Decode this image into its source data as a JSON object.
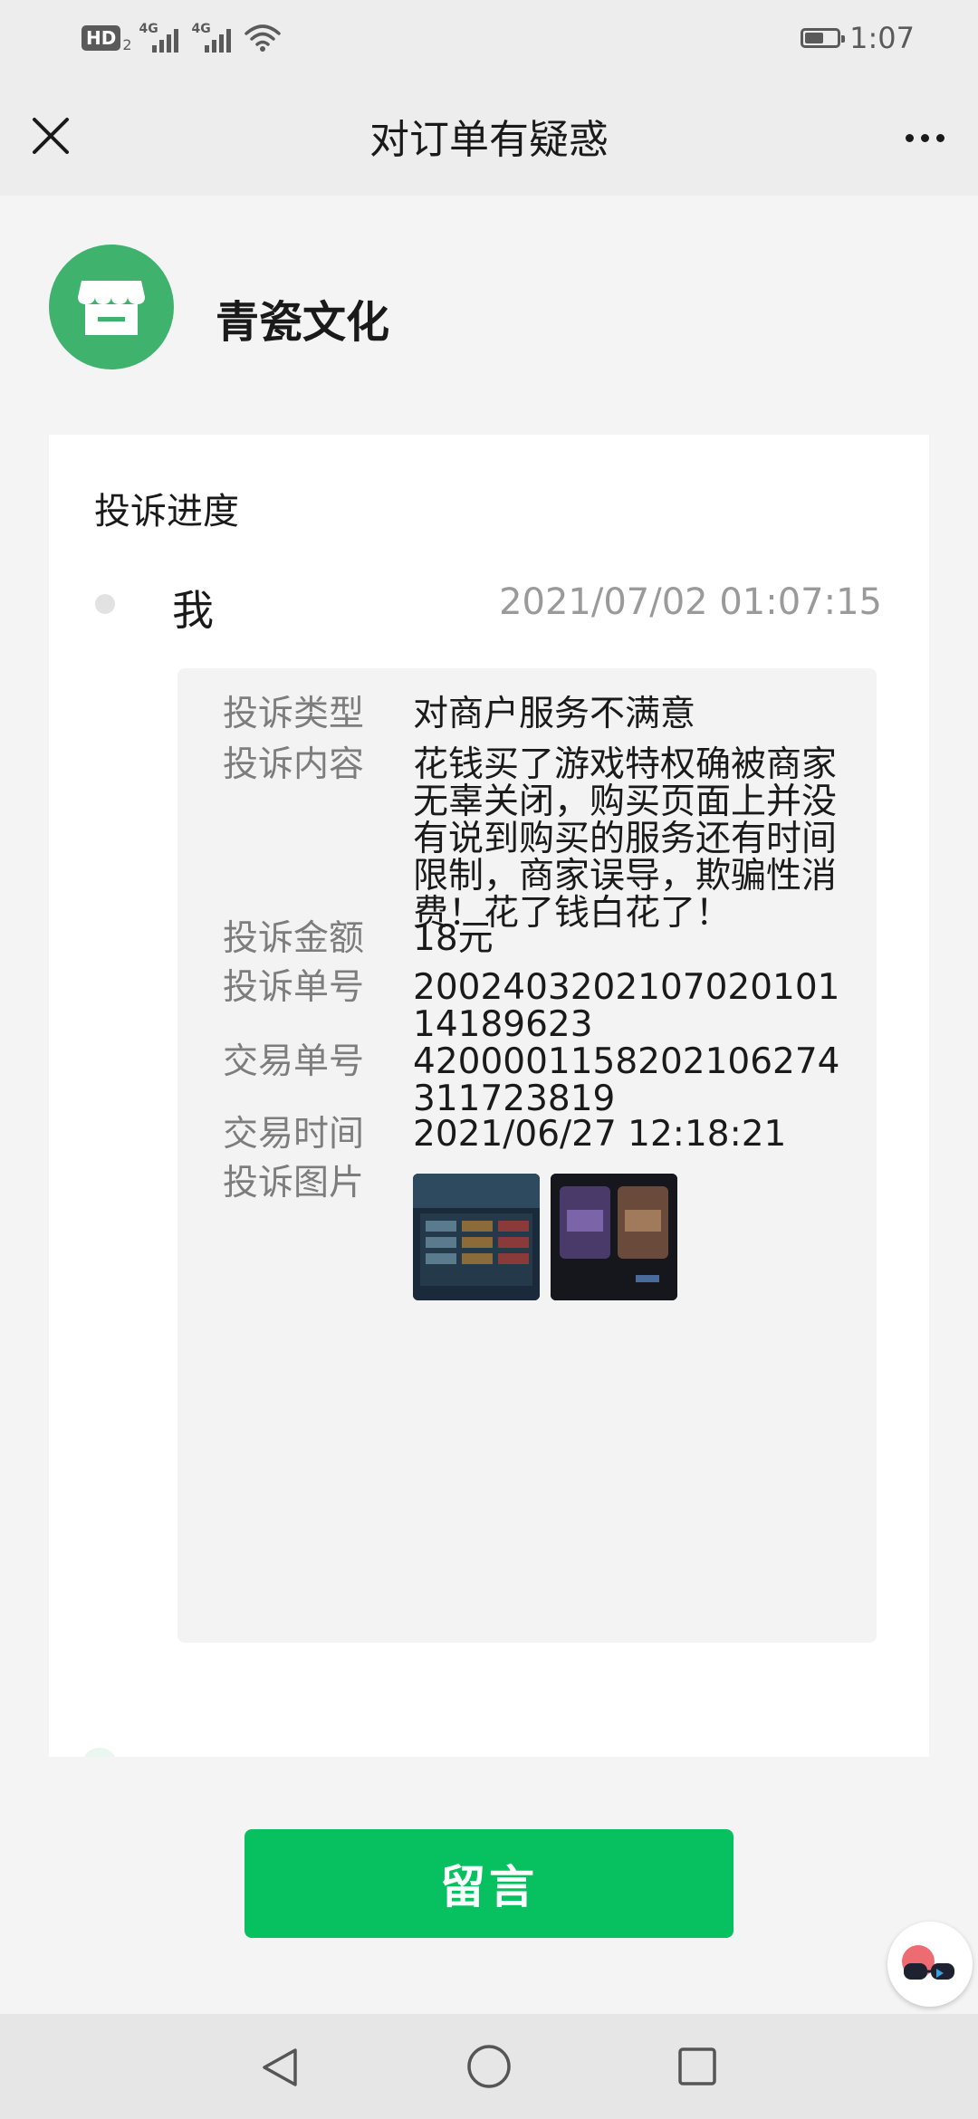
{
  "status_bar": {
    "hd": "HD",
    "hd_sub": "2",
    "network1": "4G",
    "network2": "4G",
    "battery_level": 0.6,
    "time": "1:07"
  },
  "titlebar": {
    "title": "对订单有疑惑",
    "close_icon": "close-icon",
    "more_icon": "more-icon"
  },
  "merchant": {
    "logo_icon": "store-icon",
    "name": "青瓷文化",
    "logo_color": "#3fb36e"
  },
  "progress": {
    "section_title": "投诉进度",
    "entry": {
      "who": "我",
      "time": "2021/07/02 01:07:15"
    },
    "details": [
      {
        "label": "投诉类型",
        "value": "对商户服务不满意"
      },
      {
        "label": "投诉内容",
        "value": "花钱买了游戏特权确被商家无辜关闭，购买页面上并没有说到购买的服务还有时间限制，商家误导，欺骗性消费！花了钱白花了！"
      },
      {
        "label": "投诉金额",
        "value": "18元"
      },
      {
        "label": "投诉单号",
        "value": "200240320210702010114189623"
      },
      {
        "label": "交易单号",
        "value": "4200001158202106274311723819"
      },
      {
        "label": "交易时间",
        "value": "2021/06/27 12:18:21"
      },
      {
        "label": "投诉图片",
        "value": ""
      }
    ]
  },
  "actions": {
    "comment_label": "留言",
    "accent": "#07c160"
  },
  "navbar": {
    "back_icon": "back-triangle-icon",
    "home_icon": "home-circle-icon",
    "recent_icon": "recent-square-icon"
  }
}
